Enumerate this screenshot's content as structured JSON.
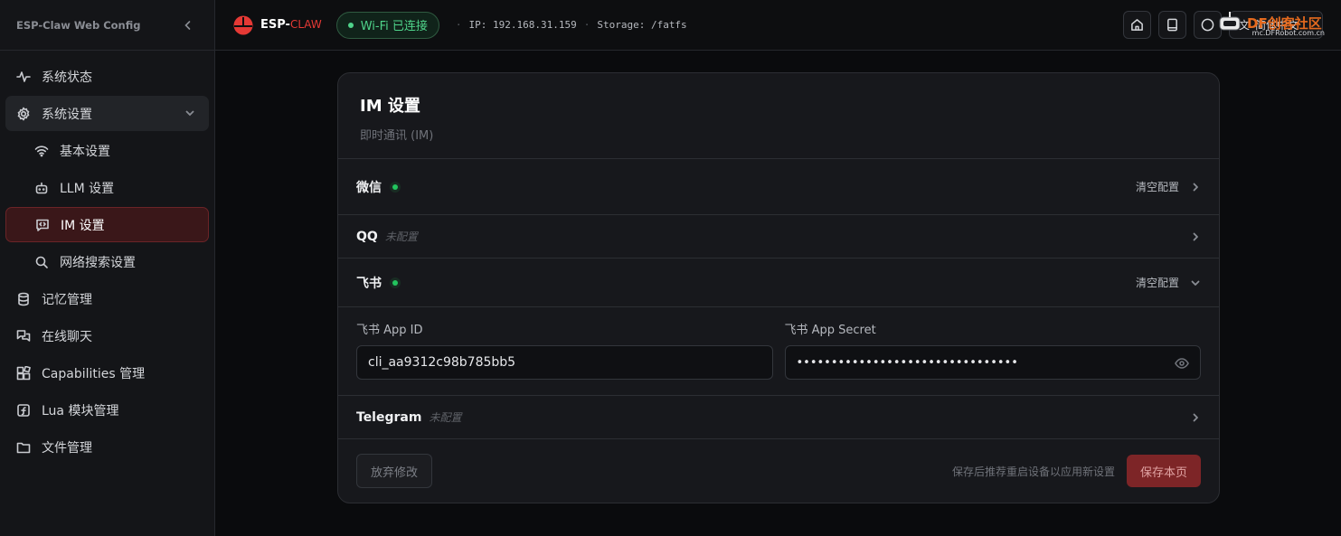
{
  "sidebar": {
    "title": "ESP-Claw Web Config",
    "items": [
      {
        "label": "系统状态"
      },
      {
        "label": "系统设置"
      },
      {
        "label": "基本设置"
      },
      {
        "label": "LLM 设置"
      },
      {
        "label": "IM 设置"
      },
      {
        "label": "网络搜索设置"
      },
      {
        "label": "记忆管理"
      },
      {
        "label": "在线聊天"
      },
      {
        "label": "Capabilities 管理"
      },
      {
        "label": "Lua 模块管理"
      },
      {
        "label": "文件管理"
      }
    ]
  },
  "topbar": {
    "brand_main": "ESP-",
    "brand_accent": "CLAW",
    "wifi_status": "Wi-Fi 已连接",
    "ip": "IP: 192.168.31.159",
    "storage": "Storage: /fatfs",
    "language": "简体中文"
  },
  "card": {
    "title": "IM 设置",
    "subtitle": "即时通讯 (IM)",
    "rows": [
      {
        "name": "微信",
        "action": "清空配置"
      },
      {
        "name": "QQ",
        "note": "未配置"
      },
      {
        "name": "飞书",
        "action": "清空配置"
      },
      {
        "name": "Telegram",
        "note": "未配置"
      }
    ],
    "fields": {
      "app_id_label": "飞书 App ID",
      "app_id_value": "cli_aa9312c98b785bb5",
      "app_secret_label": "飞书 App Secret",
      "app_secret_value": "••••••••••••••••••••••••••••••••"
    },
    "footer": {
      "discard": "放弃修改",
      "hint": "保存后推荐重启设备以应用新设置",
      "save": "保存本页"
    }
  },
  "watermark": {
    "brand": "DF创客社区",
    "url": "mc.DFRobot.com.cn"
  },
  "colors": {
    "accent": "#e53935",
    "success": "#22c55e",
    "active_bg": "#3a1719"
  }
}
